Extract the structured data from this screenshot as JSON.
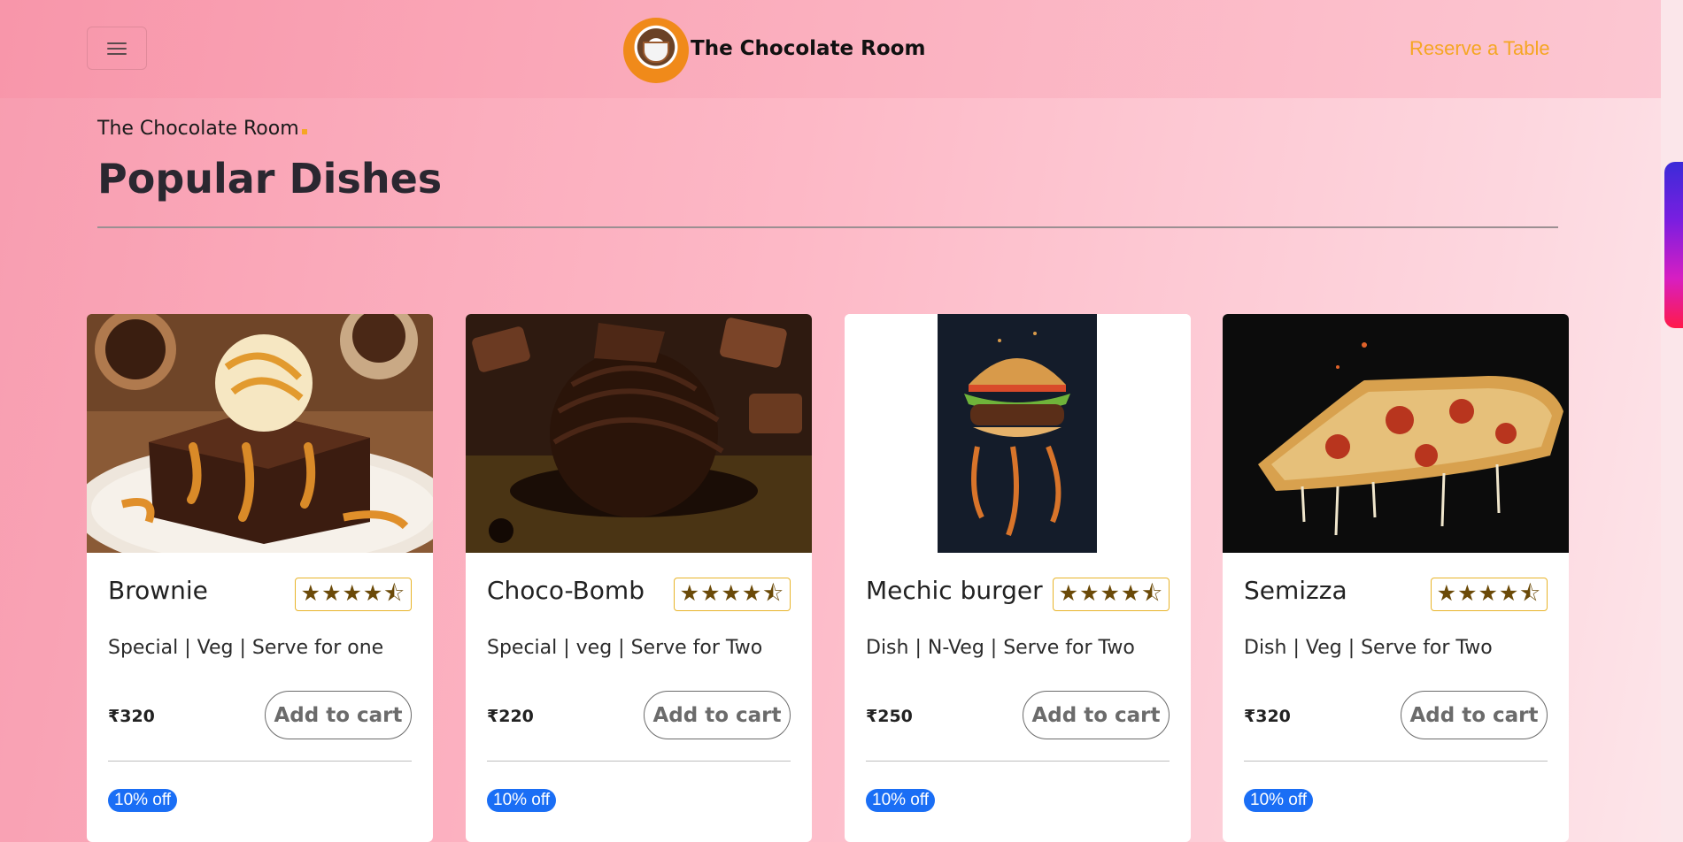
{
  "header": {
    "brand_name": "The Chocolate Room",
    "reserve_label": "Reserve a Table",
    "logo_icon": "chocolate-room-logo",
    "menu_icon": "hamburger-menu-icon"
  },
  "section": {
    "subtitle": "The Chocolate Room",
    "title": "Popular Dishes"
  },
  "colors": {
    "accent": "#f5a623",
    "badge": "#1a6ef5",
    "rating_border": "#e8b42a"
  },
  "dishes": [
    {
      "name": "Brownie",
      "rating": "★★★★⯪",
      "rating_value": 4.5,
      "desc": "Special | Veg | Serve for one",
      "price": "₹320",
      "cart_label": "Add to cart",
      "badge": "10% off",
      "image": "brownie-photo"
    },
    {
      "name": "Choco-Bomb",
      "rating": "★★★★⯪",
      "rating_value": 4.5,
      "desc": "Special | veg | Serve for Two",
      "price": "₹220",
      "cart_label": "Add to cart",
      "badge": "10% off",
      "image": "choco-bomb-photo"
    },
    {
      "name": "Mechic burger",
      "rating": "★★★★⯪",
      "rating_value": 4.5,
      "desc": "Dish | N-Veg | Serve for Two",
      "price": "₹250",
      "cart_label": "Add to cart",
      "badge": "10% off",
      "image": "burger-photo"
    },
    {
      "name": "Semizza",
      "rating": "★★★★⯪",
      "rating_value": 4.5,
      "desc": "Dish | Veg | Serve for Two",
      "price": "₹320",
      "cart_label": "Add to cart",
      "badge": "10% off",
      "image": "pizza-photo"
    }
  ]
}
